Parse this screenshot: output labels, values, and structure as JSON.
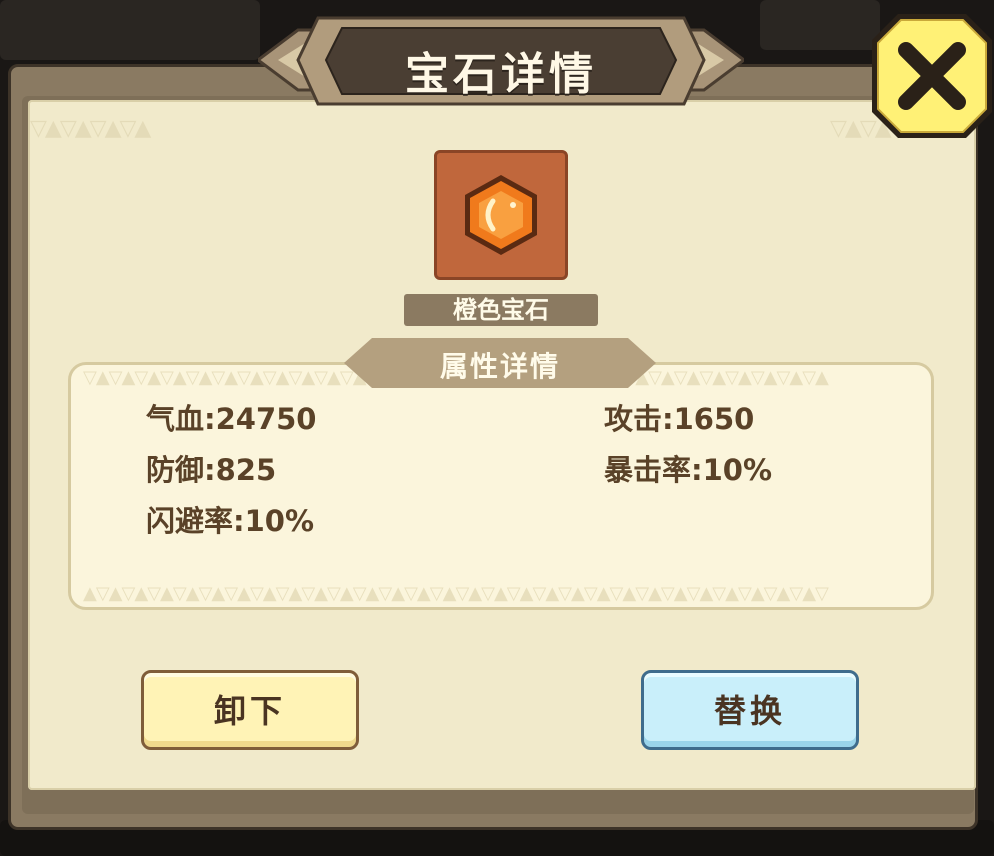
{
  "dialog": {
    "title": "宝石详情",
    "close_label": "X"
  },
  "gem": {
    "name": "橙色宝石",
    "icon": "orange-hexagon-gem-icon",
    "color": "#f07a1c"
  },
  "attributes": {
    "header": "属性详情",
    "left": [
      "气血:24750",
      "防御:825",
      "闪避率:10%"
    ],
    "right": [
      "攻击:1650",
      "暴击率:10%"
    ]
  },
  "actions": {
    "unequip_label": "卸下",
    "replace_label": "替换"
  },
  "colors": {
    "paper": "#f1eacb",
    "frame": "#8a7a62",
    "text_brown": "#5a4228",
    "close_yellow": "#fff176",
    "replace_blue": "#c9effa",
    "unequip_yellow": "#fff3b6"
  }
}
